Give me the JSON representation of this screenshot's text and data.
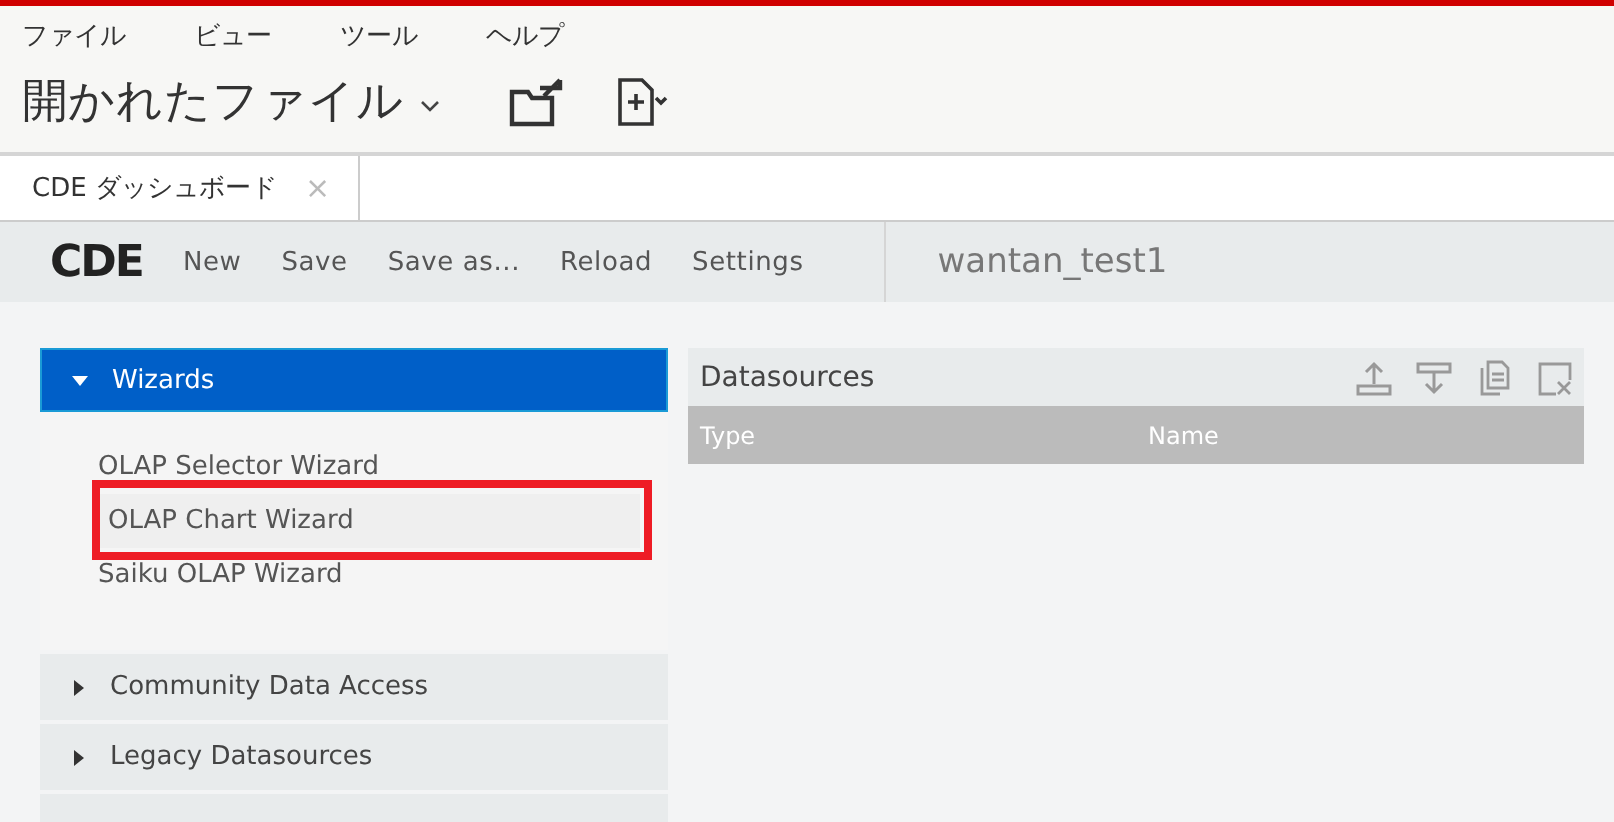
{
  "menu": [
    "ファイル",
    "ビュー",
    "ツール",
    "ヘルプ"
  ],
  "title": "開かれたファイル",
  "tabs": [
    {
      "label": "CDE ダッシュボード",
      "selected": true,
      "close": "×"
    }
  ],
  "toolbar": {
    "logo": "CDE",
    "actions": [
      "New",
      "Save",
      "Save as...",
      "Reload",
      "Settings"
    ],
    "dashboard_name": "wantan_test1"
  },
  "sidebar": {
    "sections": [
      {
        "label": "Wizards",
        "expanded": true,
        "items": [
          {
            "label": "OLAP Selector Wizard",
            "selected": false
          },
          {
            "label": "OLAP Chart Wizard",
            "selected": true
          },
          {
            "label": "Saiku OLAP Wizard",
            "selected": false
          }
        ]
      },
      {
        "label": "Community Data Access",
        "expanded": false
      },
      {
        "label": "Legacy Datasources",
        "expanded": false
      }
    ]
  },
  "datasources": {
    "title": "Datasources",
    "columns": [
      "Type",
      "Name"
    ]
  }
}
